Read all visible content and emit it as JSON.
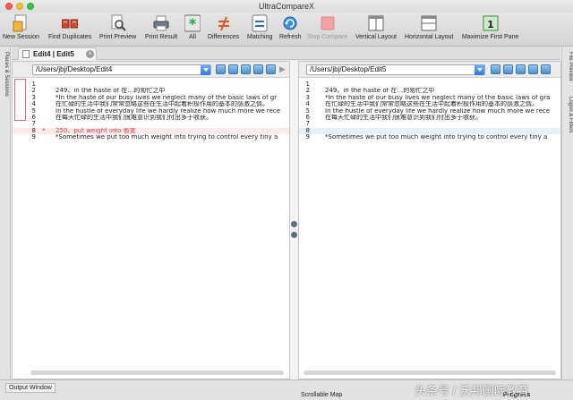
{
  "window": {
    "title": "UltraCompareX"
  },
  "toolbar": {
    "items": [
      {
        "label": "New Session",
        "icon": "new-session-icon",
        "enabled": true
      },
      {
        "label": "Find Duplicates",
        "icon": "find-duplicates-icon",
        "enabled": true
      },
      {
        "label": "Print Preview",
        "icon": "print-preview-icon",
        "enabled": true
      },
      {
        "label": "Print Result",
        "icon": "printer-icon",
        "enabled": true
      },
      {
        "label": "All",
        "icon": "all-asterisk-icon",
        "enabled": true
      },
      {
        "label": "Differences",
        "icon": "not-equal-icon",
        "enabled": true
      },
      {
        "label": "Matching",
        "icon": "equal-icon",
        "enabled": true
      },
      {
        "label": "Refresh",
        "icon": "refresh-icon",
        "enabled": true
      },
      {
        "label": "Stop Compare",
        "icon": "stop-icon",
        "enabled": false
      },
      {
        "label": "Vertical Layout",
        "icon": "vertical-layout-icon",
        "enabled": true
      },
      {
        "label": "Horizontal Layout",
        "icon": "horizontal-layout-icon",
        "enabled": true
      },
      {
        "label": "Maximize First Pane",
        "icon": "maximize-pane-icon",
        "enabled": true
      }
    ]
  },
  "sidebars": {
    "left_label": "Places & Sessions",
    "right_label_1": "File Preview",
    "right_label_2": "Logon & Filters"
  },
  "tab": {
    "label": "Edit4 | Edit5",
    "close": "×"
  },
  "left_pane": {
    "path": "/Users/jbj/Desktop/Edit4",
    "lines": [
      {
        "num": "1",
        "text": "",
        "mark": ""
      },
      {
        "num": "2",
        "text": "249、in the haste of  在…的匆忙之中",
        "mark": ""
      },
      {
        "num": "3",
        "text": "*In the haste of our busy lives we neglect many of the basic laws of gr",
        "mark": ""
      },
      {
        "num": "4",
        "text": "在忙碌的生活中我们常常忽略这些在生活中起着积极作用的基本的感激之情。",
        "mark": ""
      },
      {
        "num": "5",
        "text": "In the hustle of everyday life we hardly realize how much more we rece",
        "mark": ""
      },
      {
        "num": "6",
        "text": "在每天忙碌的生活中我们很难意识到我们付出多于收获。",
        "mark": ""
      },
      {
        "num": "7",
        "text": "",
        "mark": ""
      },
      {
        "num": "8",
        "text": "250、put weight into  看重",
        "mark": "*"
      },
      {
        "num": "9",
        "text": "*Sometimes we put too much weight into trying to control every tiny a",
        "mark": ""
      }
    ]
  },
  "right_pane": {
    "path": "/Users/jbj/Desktop/Edit5",
    "lines": [
      {
        "num": "1",
        "text": ""
      },
      {
        "num": "2",
        "text": "249、in the haste of  在…的匆忙之中"
      },
      {
        "num": "3",
        "text": "*In the haste of our busy lives we neglect many of the basic laws of gra"
      },
      {
        "num": "4",
        "text": "在忙碌的生活中我们常常忽略这些在生活中起着积极作用的基本的感激之情。"
      },
      {
        "num": "5",
        "text": "In the hustle of everyday life we hardly realize how much more we rece"
      },
      {
        "num": "6",
        "text": "在每天忙碌的生活中我们很难意识到我们付出多于收获。"
      },
      {
        "num": "7",
        "text": ""
      },
      {
        "num": "8",
        "text": ""
      },
      {
        "num": "9",
        "text": "*Sometimes we put too much weight into trying to control every tiny a"
      }
    ]
  },
  "statusbar": {
    "output_window": "Output Window",
    "scrollable_map": "Scrollable Map",
    "progress": "Progress"
  },
  "watermark": "头条号 / 沃邦国际教育",
  "colors": {
    "diff_text": "#e23b3b",
    "diff_bg": "#fdeaea",
    "accent": "#2a79e6"
  }
}
